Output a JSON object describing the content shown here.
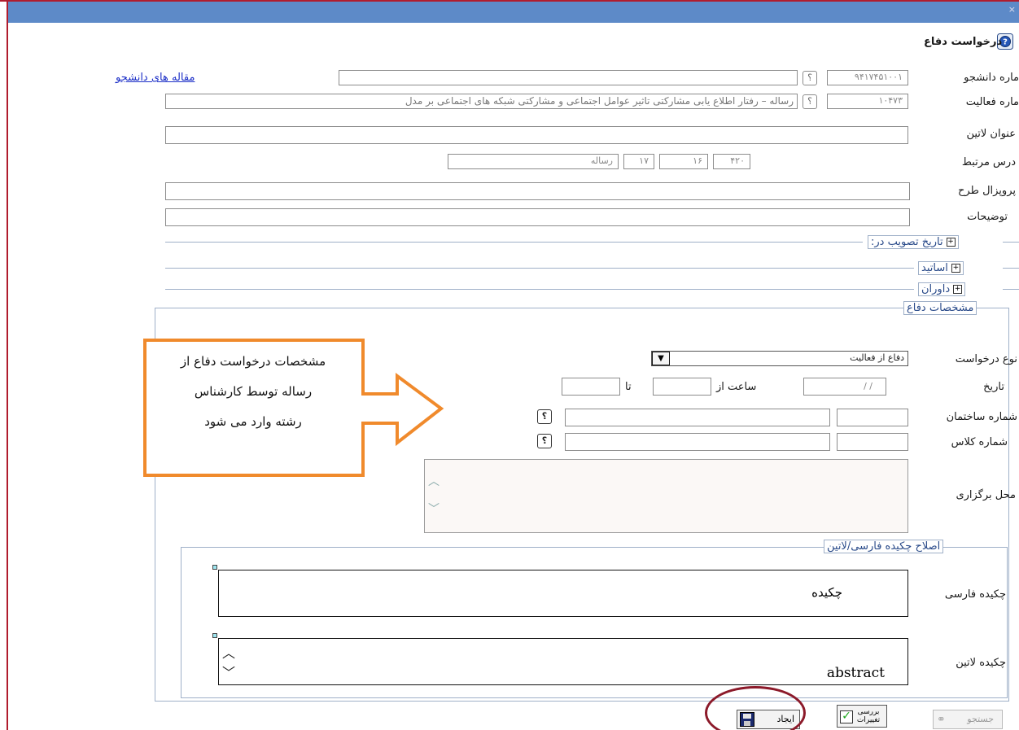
{
  "window": {
    "close_glyph": "×"
  },
  "header": {
    "title": "درخواست دفاع",
    "help_icon": "help-circle-icon"
  },
  "links": {
    "student_articles": "مقاله های دانشجو"
  },
  "fields": {
    "student_no": {
      "label": "ماره دانشجو",
      "value": "۹۴۱۷۴۵۱۰۰۱"
    },
    "activity_no": {
      "label": "ماره فعالیت",
      "value": "۱۰۴۷۳",
      "description": "رساله – رفتار اطلاع یابی مشارکتی تاثیر عوامل اجتماعی و مشارکتی شبکه های اجتماعی بر مدل"
    },
    "latin_title": {
      "label": "عنوان لاتین",
      "value": ""
    },
    "related_course": {
      "label": "درس مرتبط",
      "values": [
        "۴۲۰",
        "۱۶",
        "۱۷",
        "رساله"
      ]
    },
    "proposal": {
      "label": "پروپزال طرح",
      "value": ""
    },
    "description": {
      "label": "توضیحات",
      "value": ""
    }
  },
  "sections": {
    "approval_date": "تاریخ تصویب در:",
    "professors": "اساتید",
    "referees": "داوران",
    "defense_specs": "مشخصات دفاع",
    "abstract_fix": "اصلاح چکیده فارسی/لاتین"
  },
  "defense": {
    "request_type": {
      "label": "نوع درخواست",
      "selected": "دفاع از فعالیت"
    },
    "date": {
      "label": "تاریخ",
      "value": "/    /",
      "from_label": "ساعت از",
      "to_label": "تا"
    },
    "building_no": {
      "label": "شماره ساختمان"
    },
    "class_no": {
      "label": "شماره کلاس"
    },
    "venue": {
      "label": "محل برگزاری"
    }
  },
  "abstracts": {
    "fa": {
      "label": "چکیده فارسی",
      "value": "چکیده"
    },
    "en": {
      "label": "چکیده لاتین",
      "value": "abstract"
    }
  },
  "callout": {
    "lines": [
      "مشخصات درخواست دفاع از",
      "رساله توسط کارشناس",
      "رشته وارد می شود"
    ],
    "border_color": "#f08a2c"
  },
  "buttons": {
    "search": "جستجو",
    "review": "بررسی تغییرات",
    "create": "ایجاد"
  },
  "colors": {
    "titlebar": "#5d8ac8",
    "highlight_ring": "#8c1a2a",
    "link": "#1b2ec7"
  }
}
